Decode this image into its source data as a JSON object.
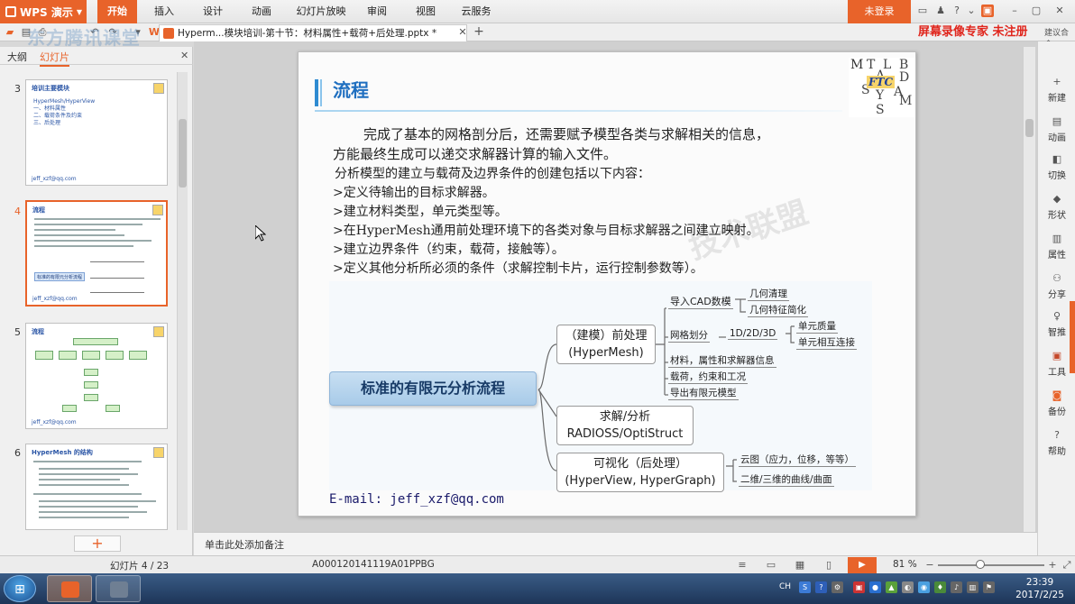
{
  "app": {
    "wps_label": "WPS 演示",
    "menu_tabs": [
      "开始",
      "插入",
      "设计",
      "动画",
      "幻灯片放映",
      "审阅",
      "视图",
      "云服务"
    ],
    "login": "未登录",
    "doc_tab": "Hypermesh模块培训-第十节：材料属性+载荷+后处理.pptx *",
    "doc_tab_display": "Hyperm...模块培训-第十节：材料属性+载荷+后处理.pptx *",
    "recorder": "屏幕录像专家 未注册",
    "recorder_extra": "建议合令",
    "watermark_top": "东方腾讯课堂"
  },
  "left_panel": {
    "tabs": [
      "大纲",
      "幻灯片"
    ],
    "active_tab": "幻灯片",
    "thumbs": [
      {
        "num": "3",
        "title": "培训主要模块",
        "lines": [
          "HyperMesh/HyperView",
          "一、材料属性",
          "二、载荷条件及约束",
          "三、后处理"
        ],
        "foot": "jeff_xzf@qq.com"
      },
      {
        "num": "4",
        "title": "流程",
        "foot": "jeff_xzf@qq.com",
        "label": "标准的有限元分析流程"
      },
      {
        "num": "5",
        "title": "流程",
        "foot": "jeff_xzf@qq.com"
      },
      {
        "num": "6",
        "title": "HyperMesh 的结构",
        "foot": ""
      }
    ],
    "add_label": "+"
  },
  "slide": {
    "title": "流程",
    "paragraph_line1": "完成了基本的网格剖分后，还需要赋予模型各类与求解相关的信息，",
    "paragraph_line2": "方能最终生成可以递交求解器计算的输入文件。",
    "intro": "分析模型的建立与载荷及边界条件的创建包括以下内容：",
    "bullets": [
      ">定义待输出的目标求解器。",
      ">建立材料类型，单元类型等。",
      ">在HyperMesh通用前处理环境下的各类对象与目标求解器之间建立映射。",
      ">建立边界条件（约束，载荷，接触等）。",
      ">定义其他分析所必须的条件（求解控制卡片，运行控制参数等）。"
    ],
    "watermark": "技术联盟",
    "email": "E-mail: jeff_xzf@qq.com",
    "logo_letters": [
      "M",
      "T",
      "L",
      "A",
      "B",
      "D",
      "S",
      "A",
      "Y",
      "M",
      "S"
    ],
    "logo_center": "FTC",
    "mindmap": {
      "root": "标准的有限元分析流程",
      "pre_line1": "（建模）前处理",
      "pre_line2": "(HyperMesh)",
      "solve_line1": "求解/分析",
      "solve_line2": "RADIOSS/OptiStruct",
      "post_line1": "可视化（后处理）",
      "post_line2": "(HyperView, HyperGraph)",
      "cad": "导入CAD数模",
      "geo_clean": "几何清理",
      "geo_simplify": "几何特征简化",
      "mesh": "网格划分",
      "dims": "1D/2D/3D",
      "quality": "单元质量",
      "connect": "单元相互连接",
      "material": "材料，属性和求解器信息",
      "loads": "载荷，约束和工况",
      "export": "导出有限元模型",
      "contour": "云图（应力，位移，等等）",
      "curves": "二维/三维的曲线/曲面"
    }
  },
  "right_tools": [
    "新建",
    "动画",
    "切换",
    "形状",
    "属性",
    "分享",
    "智推",
    "工具",
    "备份",
    "帮助"
  ],
  "notes": "单击此处添加备注",
  "status": {
    "slide_count": "幻灯片 4 / 23",
    "code": "A000120141119A01PPBG",
    "zoom": "81 %"
  },
  "taskbar": {
    "lang": "CH",
    "time": "23:39",
    "date": "2017/2/25"
  },
  "colors": {
    "accent": "#e8632a",
    "slide_title": "#1f6fc0",
    "mindmap_root": "#a8cbe9"
  }
}
